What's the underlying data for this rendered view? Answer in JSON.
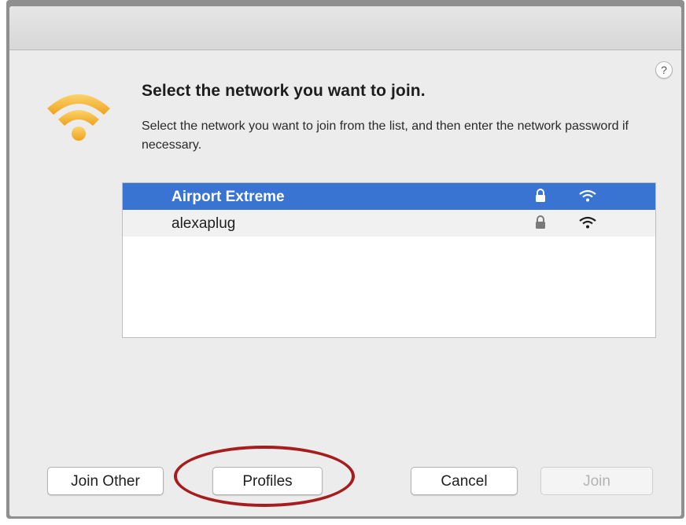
{
  "dialog": {
    "heading": "Select the network you want to join.",
    "description": "Select the network you want to join from the list, and then enter the network password if necessary.",
    "help_label": "?"
  },
  "networks": [
    {
      "name": "Airport Extreme",
      "selected": true,
      "locked": true,
      "signal_icon": "wifi-signal-icon"
    },
    {
      "name": "alexaplug",
      "selected": false,
      "locked": true,
      "signal_icon": "wifi-signal-icon"
    }
  ],
  "buttons": {
    "join_other": "Join Other",
    "profiles": "Profiles",
    "cancel": "Cancel",
    "join": "Join"
  },
  "colors": {
    "selection": "#3a74d3",
    "annotation": "#a61d1d",
    "wifi_logo": "#f5b12a"
  },
  "icons": {
    "logo": "wifi-logo-icon",
    "lock": "lock-icon",
    "signal": "wifi-signal-icon"
  }
}
